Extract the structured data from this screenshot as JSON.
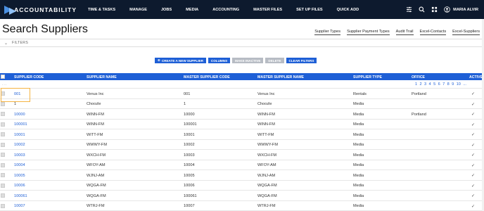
{
  "nav": {
    "brand": "ACCOUNTABILITY",
    "menu": [
      "TIME & TASKS",
      "MANAGE",
      "JOBS",
      "MEDIA",
      "ACCOUNTING",
      "MASTER FILES",
      "SET UP FILES",
      "QUICK ADD"
    ],
    "user_name": "MARIA ALVIR",
    "icons": [
      "sliders-icon",
      "search-icon",
      "grid-icon",
      "user-icon"
    ]
  },
  "page": {
    "title": "Search Suppliers",
    "links": [
      "Supplier Types",
      "Supplier Payment Types",
      "Audit Trail",
      "Excel-Contacts",
      "Excel-Suppliers"
    ],
    "filters_label": "FILTERS"
  },
  "actions": {
    "create": "CREATE A NEW SUPPLIER",
    "columns": "COLUMNS",
    "make_inactive": "MAKE INACTIVE",
    "delete": "DELETE",
    "clear_filters": "CLEAR FILTERS"
  },
  "table": {
    "headers": [
      "SUPPLIER CODE",
      "SUPPLIER NAME",
      "MASTER SUPPLIER CODE",
      "MASTER SUPPLIER NAME",
      "SUPPLIER TYPE",
      "OFFICE",
      "ACTIVE"
    ],
    "pager_dots": "...",
    "pages": [
      "1",
      "2",
      "3",
      "4",
      "5",
      "6",
      "7",
      "8",
      "9",
      "10",
      "..."
    ],
    "rows": [
      {
        "code": "001",
        "name": "Venus Inc",
        "mcode": "001",
        "mname": "Venus Inc",
        "type": "Rentals",
        "office": "Portland",
        "link": true
      },
      {
        "code": "1",
        "name": "Choozle",
        "mcode": "1",
        "mname": "Choozle",
        "type": "Media",
        "office": "",
        "link": false
      },
      {
        "code": "10000",
        "name": "WINN-FM",
        "mcode": "10000",
        "mname": "WINN-FM",
        "type": "Media",
        "office": "Portland",
        "link": true
      },
      {
        "code": "100001",
        "name": "WINN-FM",
        "mcode": "100001",
        "mname": "WINN-FM",
        "type": "Media",
        "office": "",
        "link": true
      },
      {
        "code": "10001",
        "name": "WITT-FM",
        "mcode": "10001",
        "mname": "WITT-FM",
        "type": "Media",
        "office": "",
        "link": true
      },
      {
        "code": "10002",
        "name": "WWWY-FM",
        "mcode": "10002",
        "mname": "WWWY-FM",
        "type": "Media",
        "office": "",
        "link": true
      },
      {
        "code": "10003",
        "name": "WXCH-FM",
        "mcode": "10003",
        "mname": "WXCH-FM",
        "type": "Media",
        "office": "",
        "link": true
      },
      {
        "code": "10004",
        "name": "WFOY-AM",
        "mcode": "10004",
        "mname": "WFOY-AM",
        "type": "Media",
        "office": "",
        "link": true
      },
      {
        "code": "10005",
        "name": "WJNJ-AM",
        "mcode": "10005",
        "mname": "WJNJ-AM",
        "type": "Media",
        "office": "",
        "link": true
      },
      {
        "code": "10006",
        "name": "WQGA-FM",
        "mcode": "10006",
        "mname": "WQGA-FM",
        "type": "Media",
        "office": "",
        "link": true
      },
      {
        "code": "100061",
        "name": "WQGA-FM",
        "mcode": "100061",
        "mname": "WQGA-FM",
        "type": "Media",
        "office": "",
        "link": true
      },
      {
        "code": "10007",
        "name": "WTRJ-FM",
        "mcode": "10007",
        "mname": "WTRJ-FM",
        "type": "Media",
        "office": "",
        "link": true
      }
    ]
  },
  "colors": {
    "nav_bg": "#0d1a2e",
    "accent": "#1e5fd6",
    "disabled": "#b7bcc4",
    "highlight": "#f5b342"
  }
}
